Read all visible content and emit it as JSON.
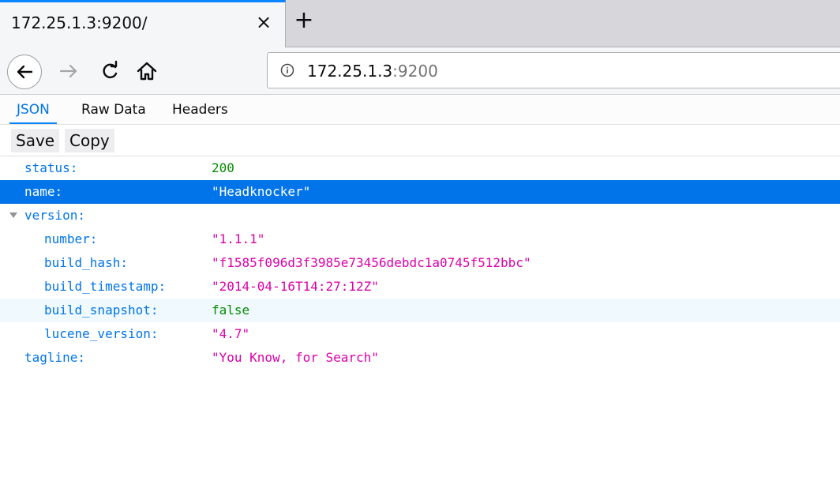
{
  "browser": {
    "tab_title": "172.25.1.3:9200/",
    "tab_close": "×",
    "new_tab": "+",
    "url_host": "172.25.1.3",
    "url_port": ":9200"
  },
  "viewer": {
    "tabs": [
      {
        "label": "JSON",
        "active": true
      },
      {
        "label": "Raw Data",
        "active": false
      },
      {
        "label": "Headers",
        "active": false
      }
    ],
    "toolbar": {
      "save_label": "Save",
      "copy_label": "Copy"
    }
  },
  "json_tree": {
    "status": {
      "key": "status:",
      "value": "200"
    },
    "name": {
      "key": "name:",
      "value": "\"Headknocker\""
    },
    "version": {
      "key": "version:"
    },
    "number": {
      "key": "number:",
      "value": "\"1.1.1\""
    },
    "build_hash": {
      "key": "build_hash:",
      "value": "\"f1585f096d3f3985e73456debdc1a0745f512bbc\""
    },
    "build_timestamp": {
      "key": "build_timestamp:",
      "value": "\"2014-04-16T14:27:12Z\""
    },
    "build_snapshot": {
      "key": "build_snapshot:",
      "value": "false"
    },
    "lucene_version": {
      "key": "lucene_version:",
      "value": "\"4.7\""
    },
    "tagline": {
      "key": "tagline:",
      "value": "\"You Know, for Search\""
    }
  },
  "colors": {
    "accent": "#0a84ff",
    "key": "#0074e8",
    "string": "#dd00a9",
    "number": "#058b00",
    "selection": "#0074e8"
  }
}
